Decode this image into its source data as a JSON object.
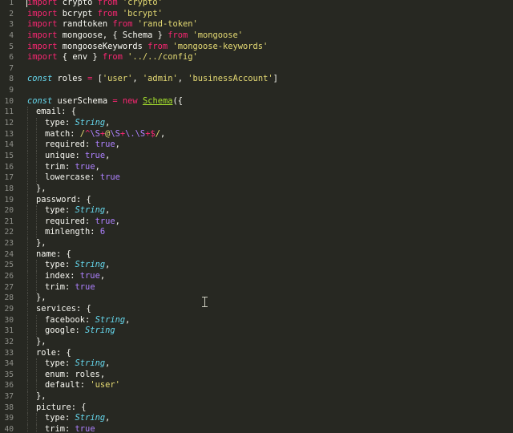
{
  "editor": {
    "theme_colors": {
      "background": "#272822",
      "keyword": "#f92672",
      "string": "#e6db74",
      "type": "#66d9ef",
      "boolean": "#ae81ff",
      "class": "#a6e22e",
      "line_number": "#8f908a"
    },
    "mouse_cursor_icon": "i-beam-cursor-icon",
    "lines": [
      {
        "n": "1",
        "indent": 0,
        "tokens": [
          [
            "kw",
            "import"
          ],
          [
            "id",
            " crypto "
          ],
          [
            "kw",
            "from"
          ],
          [
            "id",
            " "
          ],
          [
            "str",
            "'crypto'"
          ]
        ]
      },
      {
        "n": "2",
        "indent": 0,
        "tokens": [
          [
            "kw",
            "import"
          ],
          [
            "id",
            " bcrypt "
          ],
          [
            "kw",
            "from"
          ],
          [
            "id",
            " "
          ],
          [
            "str",
            "'bcrypt'"
          ]
        ]
      },
      {
        "n": "3",
        "indent": 0,
        "tokens": [
          [
            "kw",
            "import"
          ],
          [
            "id",
            " randtoken "
          ],
          [
            "kw",
            "from"
          ],
          [
            "id",
            " "
          ],
          [
            "str",
            "'rand-token'"
          ]
        ]
      },
      {
        "n": "4",
        "indent": 0,
        "tokens": [
          [
            "kw",
            "import"
          ],
          [
            "id",
            " mongoose, { Schema } "
          ],
          [
            "kw",
            "from"
          ],
          [
            "id",
            " "
          ],
          [
            "str",
            "'mongoose'"
          ]
        ]
      },
      {
        "n": "5",
        "indent": 0,
        "tokens": [
          [
            "kw",
            "import"
          ],
          [
            "id",
            " mongooseKeywords "
          ],
          [
            "kw",
            "from"
          ],
          [
            "id",
            " "
          ],
          [
            "str",
            "'mongoose-keywords'"
          ]
        ]
      },
      {
        "n": "6",
        "indent": 0,
        "tokens": [
          [
            "kw",
            "import"
          ],
          [
            "id",
            " { env } "
          ],
          [
            "kw",
            "from"
          ],
          [
            "id",
            " "
          ],
          [
            "str",
            "'../../config'"
          ]
        ]
      },
      {
        "n": "7",
        "indent": 0,
        "tokens": []
      },
      {
        "n": "8",
        "indent": 0,
        "tokens": [
          [
            "const",
            "const"
          ],
          [
            "id",
            " roles "
          ],
          [
            "kw",
            "="
          ],
          [
            "id",
            " ["
          ],
          [
            "str",
            "'user'"
          ],
          [
            "id",
            ", "
          ],
          [
            "str",
            "'admin'"
          ],
          [
            "id",
            ", "
          ],
          [
            "str",
            "'businessAccount'"
          ],
          [
            "id",
            "]"
          ]
        ]
      },
      {
        "n": "9",
        "indent": 0,
        "tokens": []
      },
      {
        "n": "10",
        "indent": 0,
        "tokens": [
          [
            "const",
            "const"
          ],
          [
            "id",
            " userSchema "
          ],
          [
            "kw",
            "="
          ],
          [
            "id",
            " "
          ],
          [
            "kw",
            "new"
          ],
          [
            "id",
            " "
          ],
          [
            "class",
            "Schema"
          ],
          [
            "id",
            "({"
          ]
        ]
      },
      {
        "n": "11",
        "indent": 1,
        "tokens": [
          [
            "id",
            "email: {"
          ]
        ]
      },
      {
        "n": "12",
        "indent": 2,
        "tokens": [
          [
            "id",
            "type: "
          ],
          [
            "type",
            "String"
          ],
          [
            "id",
            ","
          ]
        ]
      },
      {
        "n": "13",
        "indent": 2,
        "tokens": [
          [
            "id",
            "match: "
          ],
          [
            "str",
            "/"
          ],
          [
            "re-op",
            "^"
          ],
          [
            "re-esc",
            "\\S"
          ],
          [
            "re-op",
            "+"
          ],
          [
            "str",
            "@"
          ],
          [
            "re-esc",
            "\\S"
          ],
          [
            "re-op",
            "+"
          ],
          [
            "re-esc",
            "\\."
          ],
          [
            "re-esc",
            "\\S"
          ],
          [
            "re-op",
            "+"
          ],
          [
            "re-op",
            "$"
          ],
          [
            "str",
            "/"
          ],
          [
            "id",
            ","
          ]
        ]
      },
      {
        "n": "14",
        "indent": 2,
        "tokens": [
          [
            "id",
            "required: "
          ],
          [
            "bool",
            "true"
          ],
          [
            "id",
            ","
          ]
        ]
      },
      {
        "n": "15",
        "indent": 2,
        "tokens": [
          [
            "id",
            "unique: "
          ],
          [
            "bool",
            "true"
          ],
          [
            "id",
            ","
          ]
        ]
      },
      {
        "n": "16",
        "indent": 2,
        "tokens": [
          [
            "id",
            "trim: "
          ],
          [
            "bool",
            "true"
          ],
          [
            "id",
            ","
          ]
        ]
      },
      {
        "n": "17",
        "indent": 2,
        "tokens": [
          [
            "id",
            "lowercase: "
          ],
          [
            "bool",
            "true"
          ]
        ]
      },
      {
        "n": "18",
        "indent": 1,
        "tokens": [
          [
            "id",
            "},"
          ]
        ]
      },
      {
        "n": "19",
        "indent": 1,
        "tokens": [
          [
            "id",
            "password: {"
          ]
        ]
      },
      {
        "n": "20",
        "indent": 2,
        "tokens": [
          [
            "id",
            "type: "
          ],
          [
            "type",
            "String"
          ],
          [
            "id",
            ","
          ]
        ]
      },
      {
        "n": "21",
        "indent": 2,
        "tokens": [
          [
            "id",
            "required: "
          ],
          [
            "bool",
            "true"
          ],
          [
            "id",
            ","
          ]
        ]
      },
      {
        "n": "22",
        "indent": 2,
        "tokens": [
          [
            "id",
            "minlength: "
          ],
          [
            "num",
            "6"
          ]
        ]
      },
      {
        "n": "23",
        "indent": 1,
        "tokens": [
          [
            "id",
            "},"
          ]
        ]
      },
      {
        "n": "24",
        "indent": 1,
        "tokens": [
          [
            "id",
            "name: {"
          ]
        ]
      },
      {
        "n": "25",
        "indent": 2,
        "tokens": [
          [
            "id",
            "type: "
          ],
          [
            "type",
            "String"
          ],
          [
            "id",
            ","
          ]
        ]
      },
      {
        "n": "26",
        "indent": 2,
        "tokens": [
          [
            "id",
            "index: "
          ],
          [
            "bool",
            "true"
          ],
          [
            "id",
            ","
          ]
        ]
      },
      {
        "n": "27",
        "indent": 2,
        "tokens": [
          [
            "id",
            "trim: "
          ],
          [
            "bool",
            "true"
          ]
        ]
      },
      {
        "n": "28",
        "indent": 1,
        "tokens": [
          [
            "id",
            "},"
          ]
        ]
      },
      {
        "n": "29",
        "indent": 1,
        "tokens": [
          [
            "id",
            "services: {"
          ]
        ]
      },
      {
        "n": "30",
        "indent": 2,
        "tokens": [
          [
            "id",
            "facebook: "
          ],
          [
            "type",
            "String"
          ],
          [
            "id",
            ","
          ]
        ]
      },
      {
        "n": "31",
        "indent": 2,
        "tokens": [
          [
            "id",
            "google: "
          ],
          [
            "type",
            "String"
          ]
        ]
      },
      {
        "n": "32",
        "indent": 1,
        "tokens": [
          [
            "id",
            "},"
          ]
        ]
      },
      {
        "n": "33",
        "indent": 1,
        "tokens": [
          [
            "id",
            "role: {"
          ]
        ]
      },
      {
        "n": "34",
        "indent": 2,
        "tokens": [
          [
            "id",
            "type: "
          ],
          [
            "type",
            "String"
          ],
          [
            "id",
            ","
          ]
        ]
      },
      {
        "n": "35",
        "indent": 2,
        "tokens": [
          [
            "id",
            "enum: roles,"
          ]
        ]
      },
      {
        "n": "36",
        "indent": 2,
        "tokens": [
          [
            "id",
            "default: "
          ],
          [
            "str",
            "'user'"
          ]
        ]
      },
      {
        "n": "37",
        "indent": 1,
        "tokens": [
          [
            "id",
            "},"
          ]
        ]
      },
      {
        "n": "38",
        "indent": 1,
        "tokens": [
          [
            "id",
            "picture: {"
          ]
        ]
      },
      {
        "n": "39",
        "indent": 2,
        "tokens": [
          [
            "id",
            "type: "
          ],
          [
            "type",
            "String"
          ],
          [
            "id",
            ","
          ]
        ]
      },
      {
        "n": "40",
        "indent": 2,
        "tokens": [
          [
            "id",
            "trim: "
          ],
          [
            "bool",
            "true"
          ]
        ]
      }
    ]
  }
}
